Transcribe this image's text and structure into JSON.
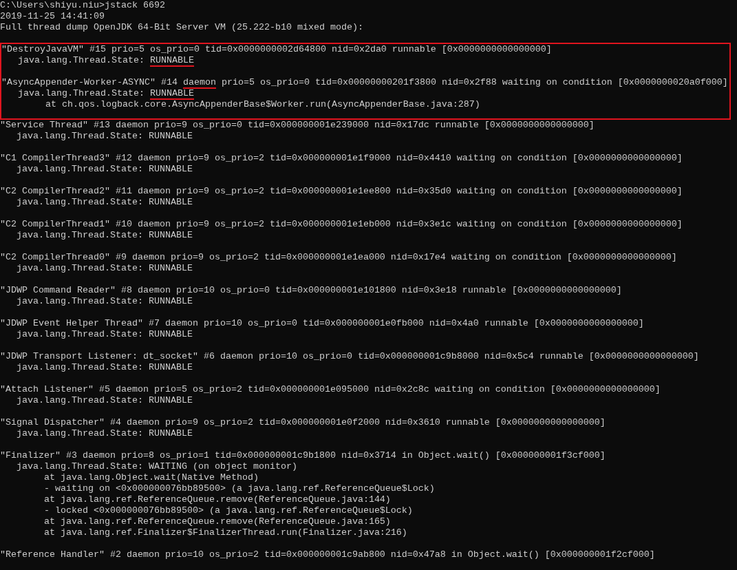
{
  "console": {
    "header": [
      {
        "parts": [
          {
            "text": "C:\\Users\\shiyu.niu>jstack 6692",
            "underlined": false
          }
        ]
      },
      {
        "parts": [
          {
            "text": "2019-11-25 14:41:09",
            "underlined": false
          }
        ]
      },
      {
        "parts": [
          {
            "text": "Full thread dump OpenJDK 64-Bit Server VM (25.222-b10 mixed mode):",
            "underlined": false
          }
        ]
      }
    ],
    "threads": [
      {
        "highlighted": true,
        "lines": [
          {
            "parts": [
              {
                "text": "\"DestroyJavaVM\" #15 prio=5 os_prio=0 tid=0x0000000002d64800 nid=0x2da0 runnable [0x0000000000000000]",
                "underlined": false
              }
            ]
          },
          {
            "parts": [
              {
                "text": "   java.lang.Thread.State: ",
                "underlined": false
              },
              {
                "text": "RUNNABLE",
                "underlined": true
              }
            ]
          }
        ]
      },
      {
        "highlighted": true,
        "lines": [
          {
            "parts": [
              {
                "text": "\"AsyncAppender-Worker-ASYNC\" #14 ",
                "underlined": false
              },
              {
                "text": "daemon",
                "underlined": true
              },
              {
                "text": " prio=5 os_prio=0 tid=0x00000000201f3800 nid=0x2f88 waiting on condition [0x0000000020a0f000]",
                "underlined": false
              }
            ]
          },
          {
            "parts": [
              {
                "text": "   java.lang.Thread.State: ",
                "underlined": false
              },
              {
                "text": "RUNNABLE",
                "underlined": true
              }
            ]
          },
          {
            "parts": [
              {
                "text": "        at ch.qos.logback.core.AsyncAppenderBase$Worker.run(AsyncAppenderBase.java:287)",
                "underlined": false
              }
            ]
          }
        ]
      },
      {
        "highlighted": false,
        "lines": [
          {
            "parts": [
              {
                "text": "\"Service Thread\" #13 daemon prio=9 os_prio=0 tid=0x000000001e239000 nid=0x17dc runnable [0x0000000000000000]",
                "underlined": false
              }
            ]
          },
          {
            "parts": [
              {
                "text": "   java.lang.Thread.State: RUNNABLE",
                "underlined": false
              }
            ]
          }
        ]
      },
      {
        "highlighted": false,
        "lines": [
          {
            "parts": [
              {
                "text": "\"C1 CompilerThread3\" #12 daemon prio=9 os_prio=2 tid=0x000000001e1f9000 nid=0x4410 waiting on condition [0x0000000000000000]",
                "underlined": false
              }
            ]
          },
          {
            "parts": [
              {
                "text": "   java.lang.Thread.State: RUNNABLE",
                "underlined": false
              }
            ]
          }
        ]
      },
      {
        "highlighted": false,
        "lines": [
          {
            "parts": [
              {
                "text": "\"C2 CompilerThread2\" #11 daemon prio=9 os_prio=2 tid=0x000000001e1ee800 nid=0x35d0 waiting on condition [0x0000000000000000]",
                "underlined": false
              }
            ]
          },
          {
            "parts": [
              {
                "text": "   java.lang.Thread.State: RUNNABLE",
                "underlined": false
              }
            ]
          }
        ]
      },
      {
        "highlighted": false,
        "lines": [
          {
            "parts": [
              {
                "text": "\"C2 CompilerThread1\" #10 daemon prio=9 os_prio=2 tid=0x000000001e1eb000 nid=0x3e1c waiting on condition [0x0000000000000000]",
                "underlined": false
              }
            ]
          },
          {
            "parts": [
              {
                "text": "   java.lang.Thread.State: RUNNABLE",
                "underlined": false
              }
            ]
          }
        ]
      },
      {
        "highlighted": false,
        "lines": [
          {
            "parts": [
              {
                "text": "\"C2 CompilerThread0\" #9 daemon prio=9 os_prio=2 tid=0x000000001e1ea000 nid=0x17e4 waiting on condition [0x0000000000000000]",
                "underlined": false
              }
            ]
          },
          {
            "parts": [
              {
                "text": "   java.lang.Thread.State: RUNNABLE",
                "underlined": false
              }
            ]
          }
        ]
      },
      {
        "highlighted": false,
        "lines": [
          {
            "parts": [
              {
                "text": "\"JDWP Command Reader\" #8 daemon prio=10 os_prio=0 tid=0x000000001e101800 nid=0x3e18 runnable [0x0000000000000000]",
                "underlined": false
              }
            ]
          },
          {
            "parts": [
              {
                "text": "   java.lang.Thread.State: RUNNABLE",
                "underlined": false
              }
            ]
          }
        ]
      },
      {
        "highlighted": false,
        "lines": [
          {
            "parts": [
              {
                "text": "\"JDWP Event Helper Thread\" #7 daemon prio=10 os_prio=0 tid=0x000000001e0fb000 nid=0x4a0 runnable [0x0000000000000000]",
                "underlined": false
              }
            ]
          },
          {
            "parts": [
              {
                "text": "   java.lang.Thread.State: RUNNABLE",
                "underlined": false
              }
            ]
          }
        ]
      },
      {
        "highlighted": false,
        "lines": [
          {
            "parts": [
              {
                "text": "\"JDWP Transport Listener: dt_socket\" #6 daemon prio=10 os_prio=0 tid=0x000000001c9b8000 nid=0x5c4 runnable [0x0000000000000000]",
                "underlined": false
              }
            ]
          },
          {
            "parts": [
              {
                "text": "   java.lang.Thread.State: RUNNABLE",
                "underlined": false
              }
            ]
          }
        ]
      },
      {
        "highlighted": false,
        "lines": [
          {
            "parts": [
              {
                "text": "\"Attach Listener\" #5 daemon prio=5 os_prio=2 tid=0x000000001e095000 nid=0x2c8c waiting on condition [0x0000000000000000]",
                "underlined": false
              }
            ]
          },
          {
            "parts": [
              {
                "text": "   java.lang.Thread.State: RUNNABLE",
                "underlined": false
              }
            ]
          }
        ]
      },
      {
        "highlighted": false,
        "lines": [
          {
            "parts": [
              {
                "text": "\"Signal Dispatcher\" #4 daemon prio=9 os_prio=2 tid=0x000000001e0f2000 nid=0x3610 runnable [0x0000000000000000]",
                "underlined": false
              }
            ]
          },
          {
            "parts": [
              {
                "text": "   java.lang.Thread.State: RUNNABLE",
                "underlined": false
              }
            ]
          }
        ]
      },
      {
        "highlighted": false,
        "lines": [
          {
            "parts": [
              {
                "text": "\"Finalizer\" #3 daemon prio=8 os_prio=1 tid=0x000000001c9b1800 nid=0x3714 in Object.wait() [0x000000001f3cf000]",
                "underlined": false
              }
            ]
          },
          {
            "parts": [
              {
                "text": "   java.lang.Thread.State: WAITING (on object monitor)",
                "underlined": false
              }
            ]
          },
          {
            "parts": [
              {
                "text": "        at java.lang.Object.wait(Native Method)",
                "underlined": false
              }
            ]
          },
          {
            "parts": [
              {
                "text": "        - waiting on <0x000000076bb89500> (a java.lang.ref.ReferenceQueue$Lock)",
                "underlined": false
              }
            ]
          },
          {
            "parts": [
              {
                "text": "        at java.lang.ref.ReferenceQueue.remove(ReferenceQueue.java:144)",
                "underlined": false
              }
            ]
          },
          {
            "parts": [
              {
                "text": "        - locked <0x000000076bb89500> (a java.lang.ref.ReferenceQueue$Lock)",
                "underlined": false
              }
            ]
          },
          {
            "parts": [
              {
                "text": "        at java.lang.ref.ReferenceQueue.remove(ReferenceQueue.java:165)",
                "underlined": false
              }
            ]
          },
          {
            "parts": [
              {
                "text": "        at java.lang.ref.Finalizer$FinalizerThread.run(Finalizer.java:216)",
                "underlined": false
              }
            ]
          }
        ]
      },
      {
        "highlighted": false,
        "lines": [
          {
            "parts": [
              {
                "text": "\"Reference Handler\" #2 daemon prio=10 os_prio=2 tid=0x000000001c9ab800 nid=0x47a8 in Object.wait() [0x000000001f2cf000]",
                "underlined": false
              }
            ]
          }
        ]
      }
    ]
  }
}
